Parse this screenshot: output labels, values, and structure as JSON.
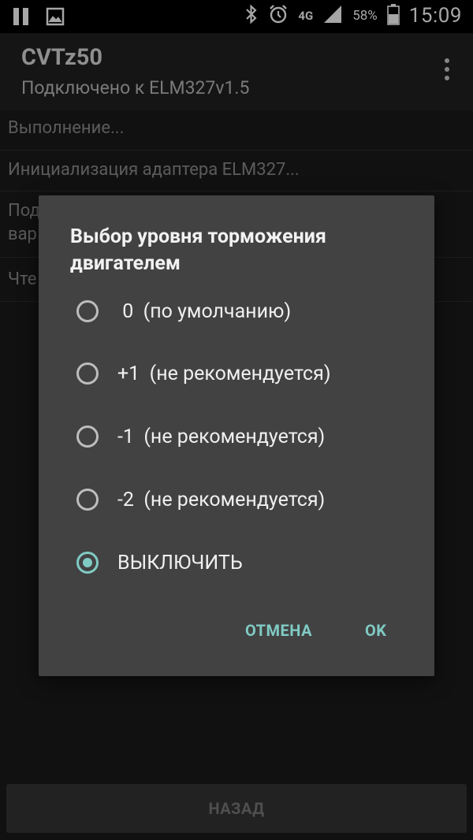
{
  "status_bar": {
    "signal_label": "4G",
    "battery": "58%",
    "time": "15:09"
  },
  "app_bar": {
    "title": "CVTz50",
    "subtitle": "Подключено к ELM327v1.5"
  },
  "log_items": [
    {
      "text": "Выполнение..."
    },
    {
      "text": "Инициализация адаптера ELM327..."
    },
    {
      "text": "Под",
      "text2": "вар"
    },
    {
      "text": "Чте"
    }
  ],
  "dialog": {
    "title": "Выбор уровня торможения двигателем",
    "options": [
      {
        "label": " 0  (по умолчанию)",
        "checked": false
      },
      {
        "label": "+1  (не рекомендуется)",
        "checked": false
      },
      {
        "label": "-1  (не рекомендуется)",
        "checked": false
      },
      {
        "label": "-2  (не рекомендуется)",
        "checked": false
      },
      {
        "label": "ВЫКЛЮЧИТЬ",
        "checked": true
      }
    ],
    "cancel_label": "ОТМЕНА",
    "ok_label": "OK"
  },
  "footer": {
    "back_label": "НАЗАД"
  },
  "colors": {
    "accent": "#80cbc4",
    "dialog_bg": "#424242",
    "app_bg": "#1b1b1b"
  }
}
